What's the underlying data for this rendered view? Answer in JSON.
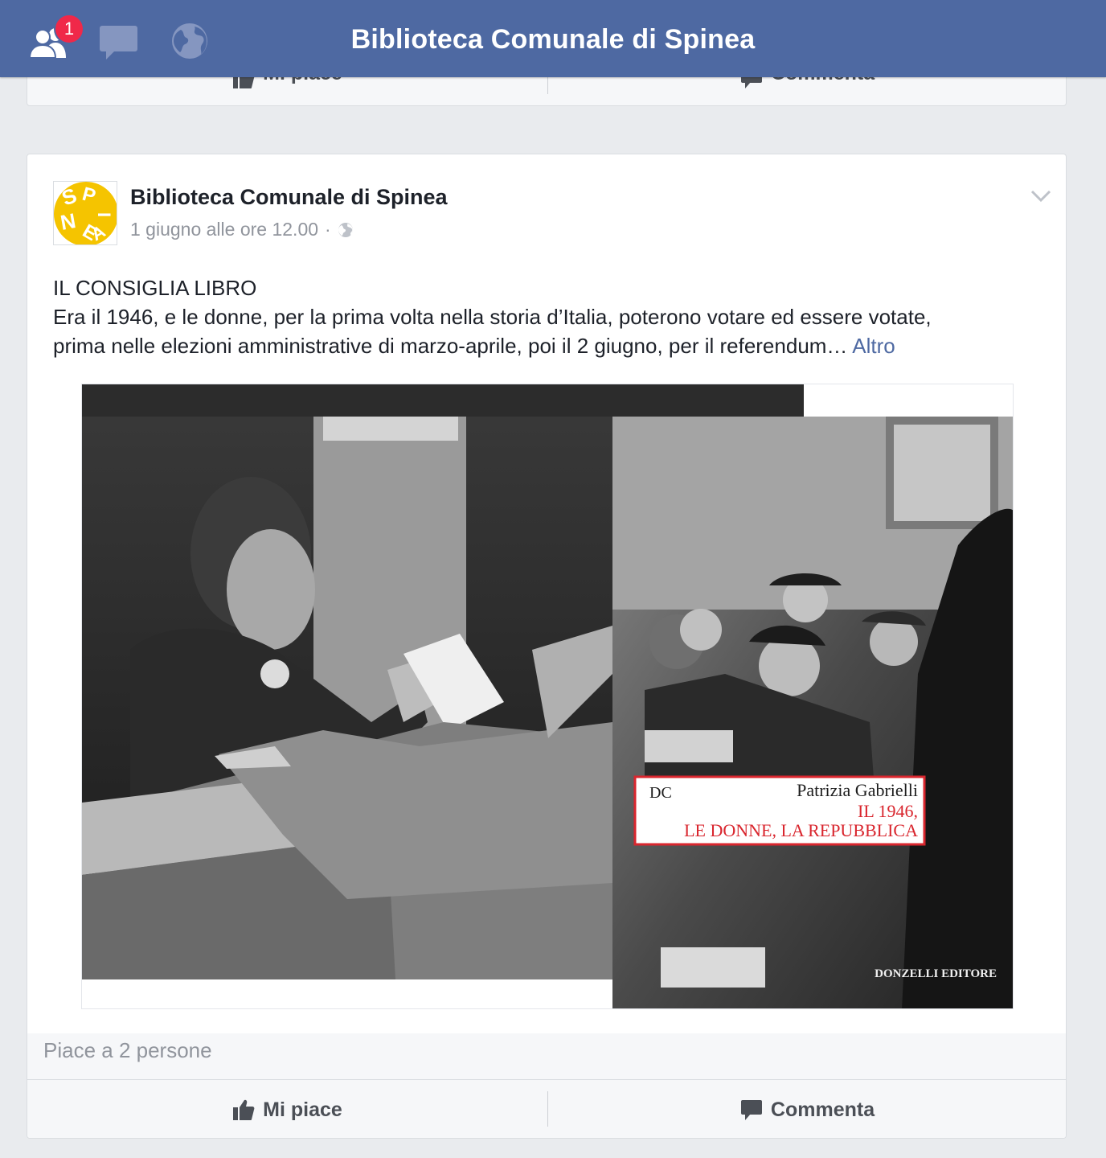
{
  "topbar": {
    "title": "Biblioteca Comunale di Spinea",
    "friend_requests_count": "1",
    "icons": [
      "friends-icon",
      "messages-icon",
      "notifications-globe-icon"
    ],
    "color": "#4e69a2"
  },
  "previous_post": {
    "like_label": "Mi piace",
    "comment_label": "Commenta"
  },
  "post": {
    "author": "Biblioteca Comunale di Spinea",
    "timestamp": "1 giugno alle ore 12.00",
    "separator": "·",
    "privacy_icon": "globe-icon",
    "text_line1": "IL CONSIGLIA LIBRO",
    "text_line2": "Era il 1946, e le donne, per la prima volta nella storia d’Italia, poterono votare ed essere votate,",
    "text_line3": "prima nelle elezioni amministrative di marzo-aprile, poi il 2 giugno, per il referendum…",
    "more_link": "Altro",
    "avatar_letters": "SPINEA",
    "image": {
      "book_author": "Patrizia Gabrielli",
      "book_title_line1": "IL 1946,",
      "book_title_line2": "LE DONNE, LA REPUBBLICA",
      "publisher": "DONZELLI EDITORE",
      "publisher_mark": "DC"
    },
    "likes_summary": "Piace a 2 persone",
    "like_label": "Mi piace",
    "comment_label": "Commenta"
  }
}
